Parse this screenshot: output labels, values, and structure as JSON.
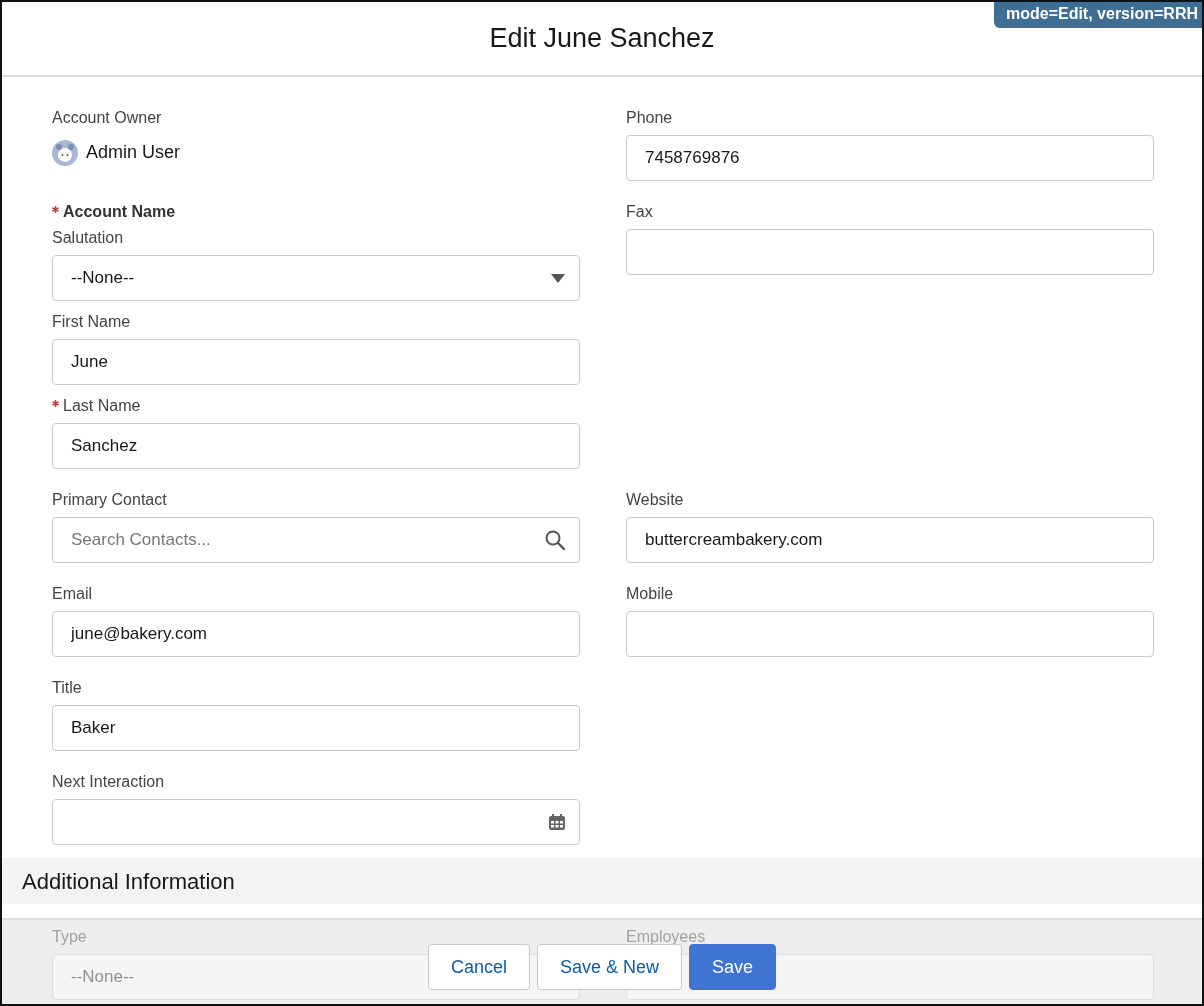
{
  "title": "Edit June Sanchez",
  "badge": "mode=Edit, version=RRH",
  "rows": [
    {
      "left": {
        "kind": "owner",
        "label": "Account Owner",
        "value": "Admin User"
      },
      "right": {
        "kind": "text",
        "label": "Phone",
        "value": "7458769876"
      }
    },
    {
      "left": {
        "kind": "group",
        "label": "Account Name",
        "required": true,
        "fields": [
          {
            "kind": "select",
            "label": "Salutation",
            "value": "--None--"
          },
          {
            "kind": "text",
            "label": "First Name",
            "value": "June"
          },
          {
            "kind": "text",
            "label": "Last Name",
            "required": true,
            "value": "Sanchez"
          }
        ]
      },
      "right": {
        "kind": "text",
        "label": "Fax"
      }
    },
    {
      "left": {
        "kind": "lookup",
        "label": "Primary Contact",
        "placeholder": "Search Contacts..."
      },
      "right": {
        "kind": "text",
        "label": "Website",
        "value": "buttercreambakery.com"
      }
    },
    {
      "left": {
        "kind": "text",
        "label": "Email",
        "value": "june@bakery.com"
      },
      "right": {
        "kind": "text",
        "label": "Mobile"
      }
    },
    {
      "left": {
        "kind": "text",
        "label": "Title",
        "value": "Baker"
      }
    },
    {
      "left": {
        "kind": "date",
        "label": "Next Interaction"
      }
    }
  ],
  "section": {
    "title": "Additional Information",
    "fields": [
      {
        "kind": "select",
        "label": "Type",
        "value": "--None--"
      },
      {
        "kind": "text",
        "label": "Employees"
      }
    ]
  },
  "buttons": [
    {
      "label": "Cancel",
      "kind": "neutral"
    },
    {
      "label": "Save & New",
      "kind": "neutral"
    },
    {
      "label": "Save",
      "kind": "brand"
    }
  ]
}
